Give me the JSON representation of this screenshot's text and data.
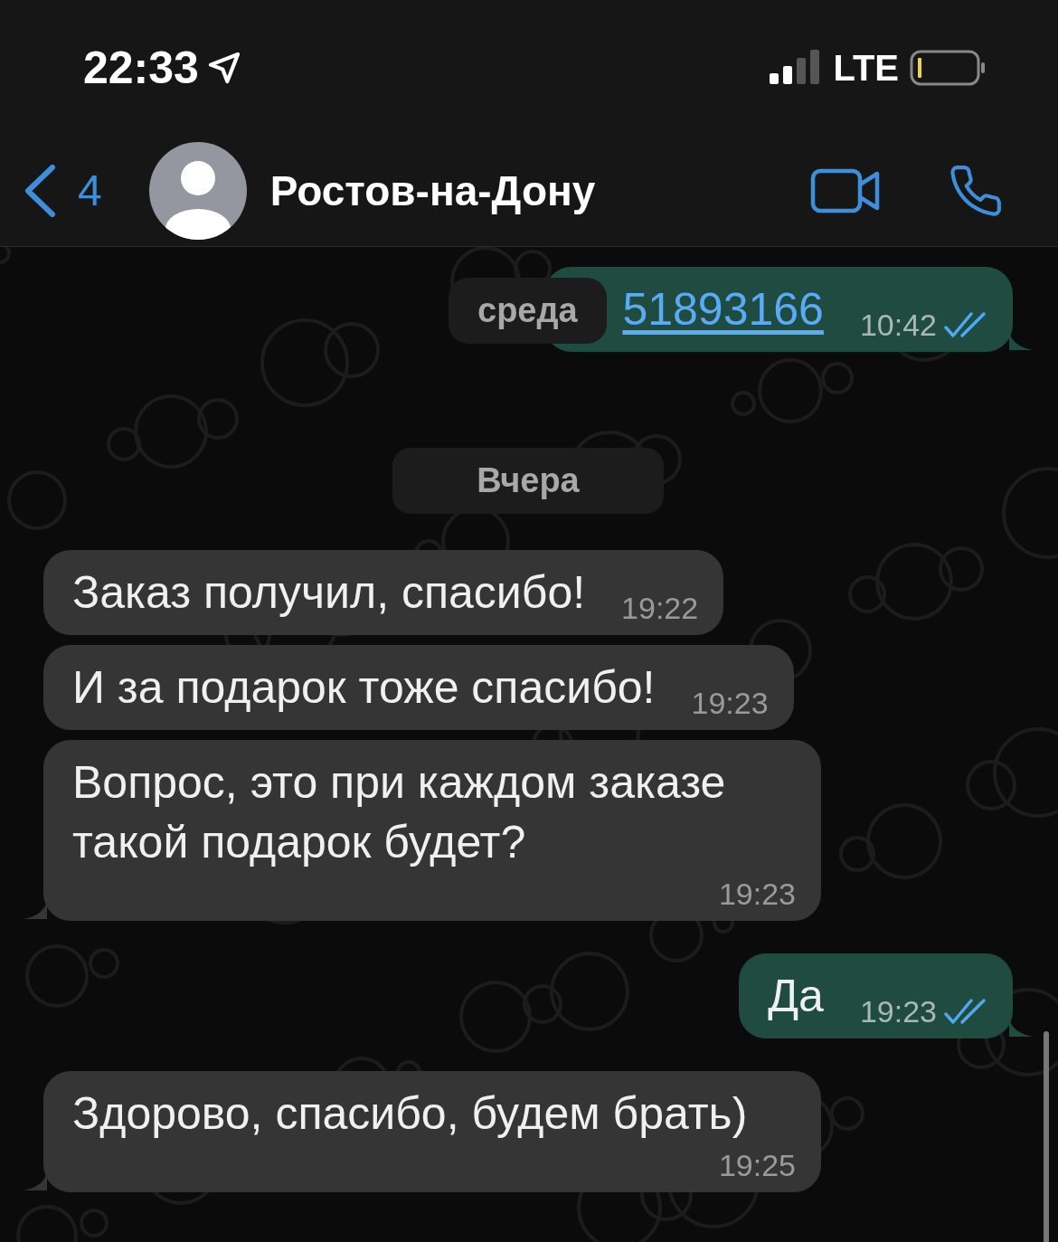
{
  "status_bar": {
    "time": "22:33",
    "network": "LTE"
  },
  "header": {
    "back_count": "4",
    "title": "Ростов-на-Дону"
  },
  "floating_date": "среда",
  "messages": [
    {
      "kind": "outgoing",
      "text": "51893166",
      "link": true,
      "time": "10:42",
      "read": true,
      "tail": true
    },
    {
      "kind": "date",
      "text": "Вчера"
    },
    {
      "kind": "incoming",
      "text": "Заказ получил, спасибо!",
      "link": false,
      "time": "19:22",
      "tail": false
    },
    {
      "kind": "incoming",
      "text": "И за подарок тоже спасибо!",
      "link": false,
      "time": "19:23",
      "tail": false
    },
    {
      "kind": "incoming",
      "text": "Вопрос, это при каждом заказе такой подарок будет?",
      "link": false,
      "time": "19:23",
      "tail": true
    },
    {
      "kind": "outgoing",
      "text": "Да",
      "link": false,
      "time": "19:23",
      "read": true,
      "tail": true
    },
    {
      "kind": "incoming",
      "text": "Здорово, спасибо, будем брать)",
      "link": false,
      "time": "19:25",
      "tail": true
    }
  ]
}
